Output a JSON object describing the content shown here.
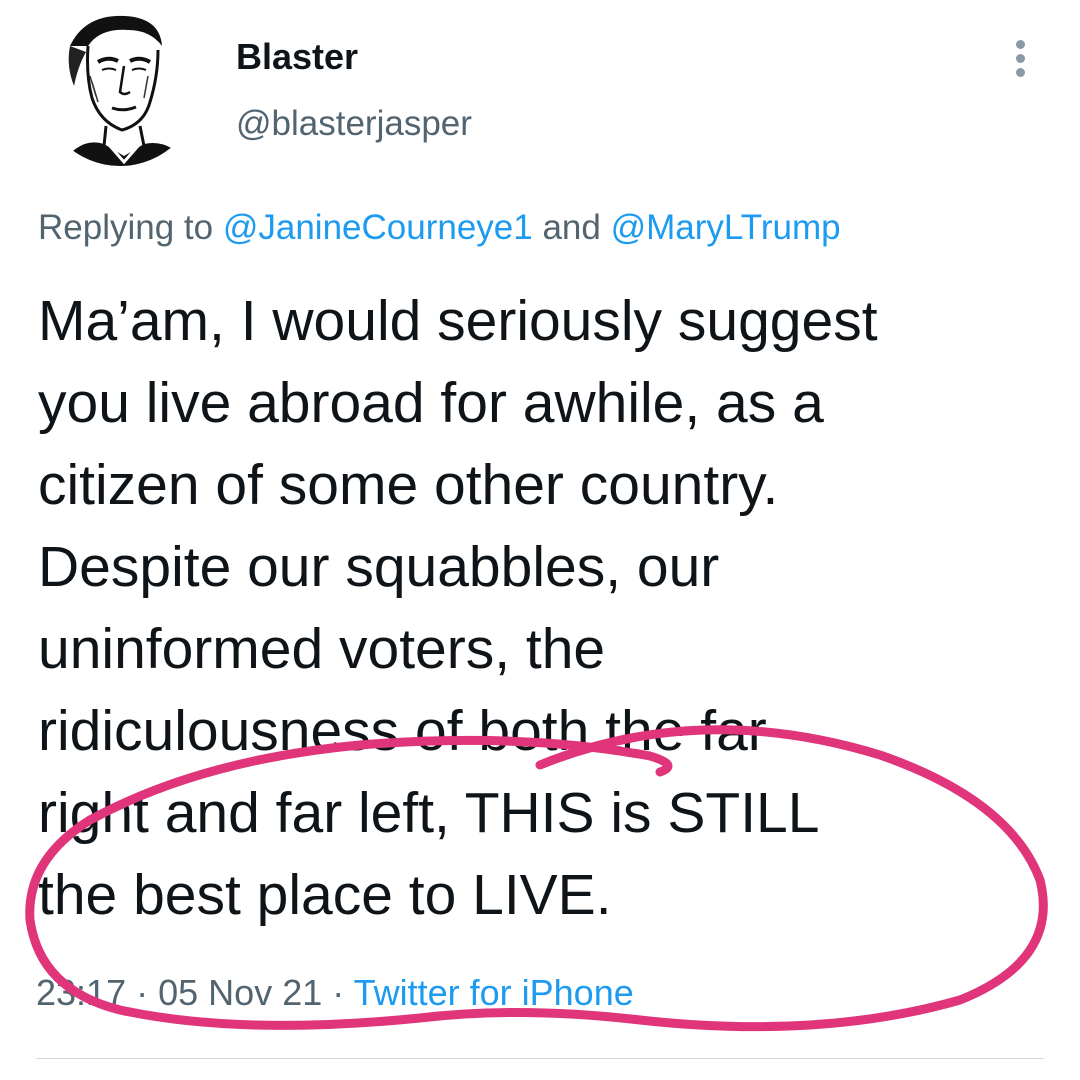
{
  "user": {
    "display_name": "Blaster",
    "handle": "@blasterjasper",
    "avatar_icon": "sketch-portrait-avatar"
  },
  "reply": {
    "prefix": "Replying to",
    "mention1": "@JanineCourneye1",
    "connector": "and",
    "mention2": "@MaryLTrump"
  },
  "tweet": {
    "lines": [
      "Ma’am, I would seriously suggest",
      "you live abroad for awhile, as a",
      "citizen of some other country.",
      "Despite our squabbles, our",
      "uninformed voters, the",
      "ridiculousness of both the far",
      "right and far left, THIS is STILL",
      "the best place to LIVE."
    ]
  },
  "meta": {
    "time": "23:17",
    "separator1": "·",
    "date": "05 Nov 21",
    "separator2": "·",
    "source": "Twitter for iPhone"
  },
  "colors": {
    "text": "#0f1419",
    "secondary": "#536471",
    "link": "#1d9bf0",
    "annotation": "#e0357a"
  },
  "icons": {
    "more": "more-vertical-icon"
  }
}
